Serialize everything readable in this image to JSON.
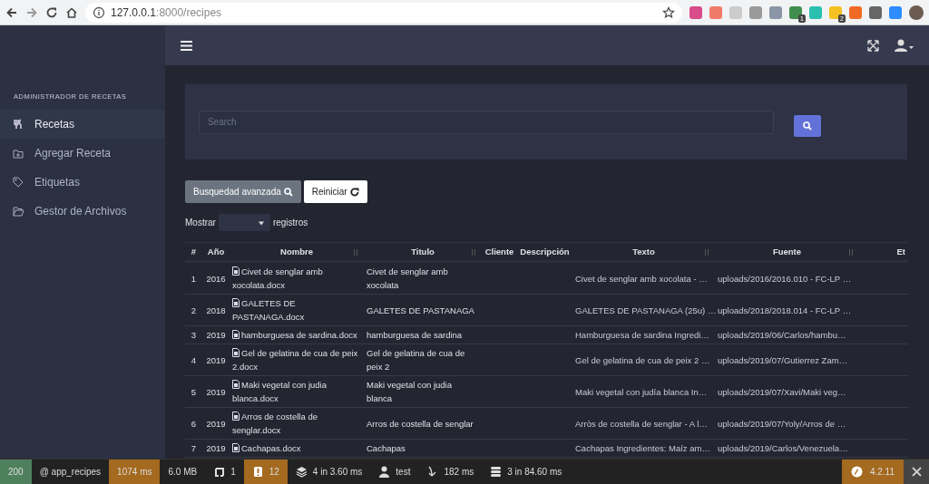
{
  "browser": {
    "url_host": "127.0.0.1",
    "url_path": ":8000/recipes",
    "extensions": [
      {
        "color": "#d94c8a"
      },
      {
        "color": "#f07a6a"
      },
      {
        "color": "#cccccc"
      },
      {
        "color": "#9a9a9a"
      },
      {
        "color": "#8a95a5"
      },
      {
        "color": "#3f8e4e",
        "badge": "1"
      },
      {
        "color": "#2bbfb0"
      },
      {
        "color": "#f5c022",
        "badge": "2"
      },
      {
        "color": "#f06a25"
      },
      {
        "color": "#666666"
      },
      {
        "color": "#2d8cff"
      }
    ]
  },
  "sidebar": {
    "heading": "ADMINISTRADOR DE RECETAS",
    "items": [
      {
        "label": "Recetas",
        "selected": true
      },
      {
        "label": "Agregar Receta",
        "selected": false
      },
      {
        "label": "Etiquetas",
        "selected": false
      },
      {
        "label": "Gestor de Archivos",
        "selected": false
      }
    ]
  },
  "search": {
    "placeholder": "Search"
  },
  "buttons": [
    {
      "label": "Busquedad avanzada",
      "kind": "advanced"
    },
    {
      "label": "Reiniciar",
      "kind": "reset"
    }
  ],
  "page_length": {
    "before": "Mostrar",
    "after": "registros"
  },
  "table": {
    "columns": [
      {
        "label": "#",
        "sortable": false
      },
      {
        "label": "Año",
        "sortable": false
      },
      {
        "label": "Nombre",
        "sortable": true
      },
      {
        "label": "Titulo",
        "sortable": true
      },
      {
        "label": "Cliente",
        "sortable": false
      },
      {
        "label": "Descripción",
        "sortable": false
      },
      {
        "label": "Texto",
        "sortable": true
      },
      {
        "label": "Fuente",
        "sortable": true
      },
      {
        "label": "Et",
        "sortable": false
      }
    ],
    "rows": [
      {
        "n": "1",
        "year": "2016",
        "file": "Civet de senglar amb xocolata.docx",
        "title": "Civet de senglar amb xocolata",
        "text": "Civet de senglar amb xocolata - …",
        "source": "uploads/2016/2016.010 - FC-LP …"
      },
      {
        "n": "2",
        "year": "2018",
        "file": "GALETES DE PASTANAGA.docx",
        "title": "GALETES DE PASTANAGA",
        "text": "GALETES DE PASTANAGA (25u) …",
        "source": "uploads/2018/2018.014 - FC-LP …"
      },
      {
        "n": "3",
        "year": "2019",
        "file": "hamburguesa de sardina.docx",
        "title": "hamburguesa de sardina",
        "text": "Hamburguesa de sardina Ingredi…",
        "source": "uploads/2019/06/Carlos/hambu…"
      },
      {
        "n": "4",
        "year": "2019",
        "file": "Gel de gelatina de cua de peix 2.docx",
        "title": "Gel de gelatina de cua de peix 2",
        "text": "Gel de gelatina de cua de peix 2 …",
        "source": "uploads/2019/07/Gutierrez Zam…"
      },
      {
        "n": "5",
        "year": "2019",
        "file": "Maki vegetal con judia blanca.docx",
        "title": "Maki vegetal con judia blanca",
        "text": "Maki vegetal con judía blanca In…",
        "source": "uploads/2019/07/Xavi/Maki veg…"
      },
      {
        "n": "6",
        "year": "2019",
        "file": "Arros de costella de senglar.docx",
        "title": "Arros de costella de senglar",
        "text": "Arròs de costella de senglar - A l…",
        "source": "uploads/2019/07/Yoly/Arros de …"
      },
      {
        "n": "7",
        "year": "2019",
        "file": "Cachapas.docx",
        "title": "Cachapas",
        "text": "Cachapas Ingredientes: Maíz am…",
        "source": "uploads/2019/Carlos/Venezuela…"
      }
    ]
  },
  "debug_toolbar": {
    "items": [
      {
        "text": "200",
        "color": "#4f805d"
      },
      {
        "text": "@ app_recipes",
        "color": "#222222"
      },
      {
        "text": "1074 ms",
        "color": "#a46a1f"
      },
      {
        "text": "6.0 MB",
        "color": "#222222"
      },
      {
        "text": "1",
        "color": "#222222"
      },
      {
        "text": "12",
        "color": "#a46a1f"
      },
      {
        "text": "4 in 3.60 ms",
        "color": "#222222"
      },
      {
        "text": "test",
        "color": "#222222"
      },
      {
        "text": "182 ms",
        "color": "#222222"
      },
      {
        "text": "3 in 84.60 ms",
        "color": "#222222"
      }
    ],
    "version": "4.2.11"
  }
}
